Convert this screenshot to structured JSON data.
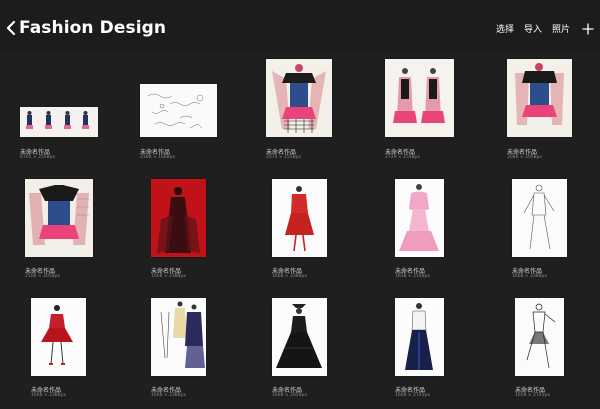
{
  "header": {
    "title": "Fashion Design",
    "select_label": "选择",
    "import_label": "导入",
    "photos_label": "照片"
  },
  "gallery": {
    "items": [
      {
        "name": "未命名作品",
        "size": "6705 × 2558px"
      },
      {
        "name": "未命名作品",
        "size": "2308 × 1668px"
      },
      {
        "name": "未命名作品",
        "size": "2074 × 2558px"
      },
      {
        "name": "未命名作品",
        "size": "2729 × 2548px"
      },
      {
        "name": "未命名作品",
        "size": "2086 × 2058px"
      },
      {
        "name": "未命名作品",
        "size": "2106 × 2058px"
      },
      {
        "name": "未命名作品",
        "size": "1668 × 2388px"
      },
      {
        "name": "未命名作品",
        "size": "1668 × 2388px"
      },
      {
        "name": "未命名作品",
        "size": "1658 × 2148px"
      },
      {
        "name": "未命名作品",
        "size": "1668 × 2388px"
      },
      {
        "name": "未命名作品",
        "size": "1668 × 2388px"
      },
      {
        "name": "未命名作品",
        "size": "1668 × 2388px"
      },
      {
        "name": "未命名作品",
        "size": "1668 × 2058px"
      },
      {
        "name": "未命名作品",
        "size": "1668 × 2743px"
      },
      {
        "name": "未命名作品",
        "size": "1658 × 2743px"
      }
    ]
  }
}
